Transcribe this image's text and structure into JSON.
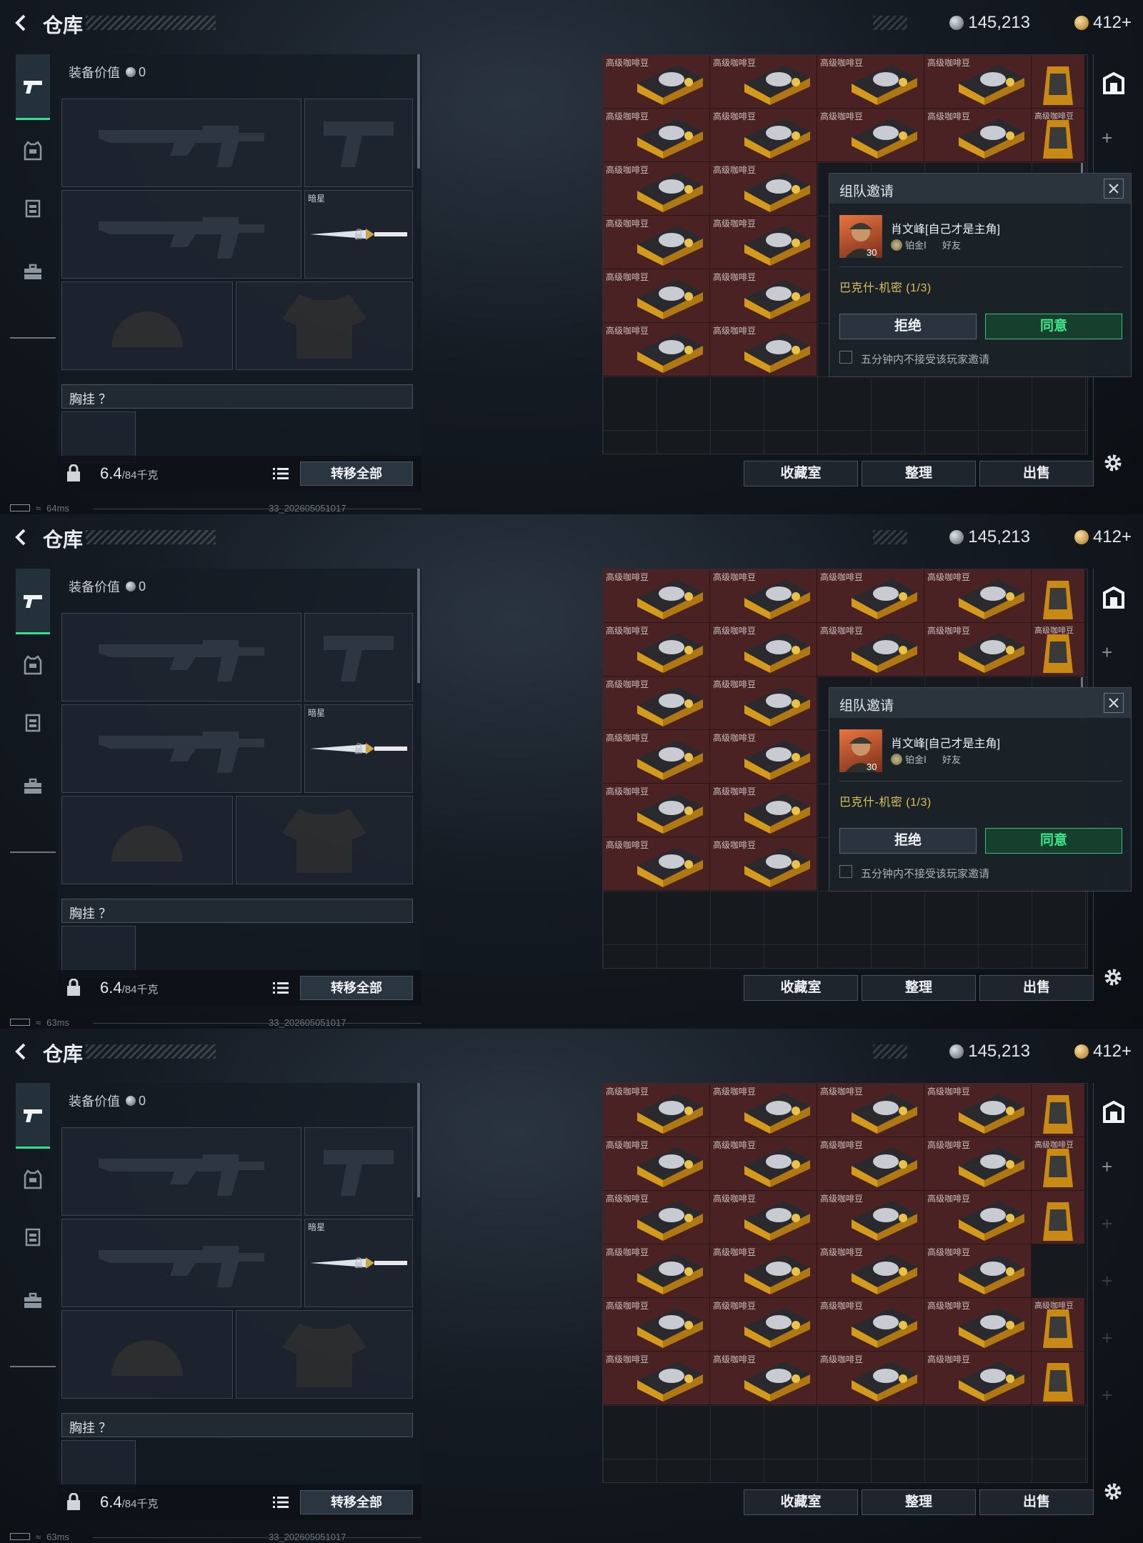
{
  "header": {
    "title": "仓库",
    "silver_coins": "145,213",
    "gold_coins": "412+"
  },
  "equipment": {
    "value_label": "装备价值",
    "value": "0",
    "melee_name": "暗星",
    "chest_rig_label": "胸挂 ？",
    "weight_value": "6.4",
    "weight_unit": "/84千克",
    "transfer_all": "转移全部"
  },
  "stash": {
    "item_name": "高级咖啡豆",
    "buttons": {
      "collection": "收藏室",
      "sort": "整理",
      "sell": "出售"
    }
  },
  "invite_dialog": {
    "title": "组队邀请",
    "player_name": "肖文峰[自己才是主角]",
    "player_level": "30",
    "rank": "铂金Ⅰ",
    "relation": "好友",
    "mission": "巴克什-机密 (1/3)",
    "reject": "拒绝",
    "accept": "同意",
    "mute_label": "五分钟内不接受该玩家邀请"
  },
  "status_bar": [
    {
      "ping": "64ms",
      "build": "33_202605051017"
    },
    {
      "ping": "63ms",
      "build": "33_202605051017"
    },
    {
      "ping": "63ms",
      "build": "33_202605051017"
    }
  ],
  "panels": [
    {
      "show_invite": true
    },
    {
      "show_invite": true
    },
    {
      "show_invite": false
    }
  ],
  "colors": {
    "accent_green": "#2ee38f",
    "item_bg": "#4b2224",
    "mission_text": "#d8c25a"
  }
}
